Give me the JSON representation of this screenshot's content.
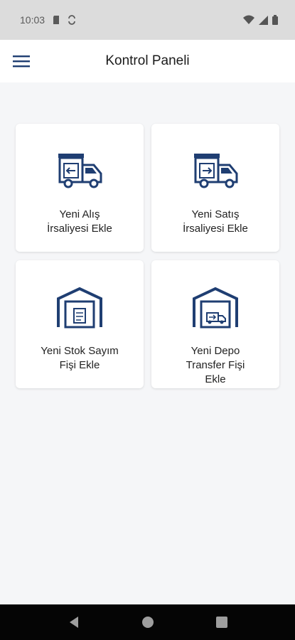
{
  "status_bar": {
    "time": "10:03",
    "icons": [
      "sd-card-icon",
      "sync-icon",
      "wifi-icon",
      "signal-icon",
      "battery-icon"
    ]
  },
  "app_bar": {
    "title": "Kontrol Paneli",
    "menu_icon": "hamburger-menu-icon"
  },
  "dashboard": {
    "cards": [
      {
        "label": "Yeni Alış\nİrsaliyesi Ekle",
        "icon": "truck-receive-icon"
      },
      {
        "label": "Yeni Satış\nİrsaliyesi Ekle",
        "icon": "truck-send-icon"
      },
      {
        "label": "Yeni Stok Sayım\nFişi Ekle",
        "icon": "warehouse-count-icon"
      },
      {
        "label": "Yeni Depo\nTransfer Fişi\nEkle",
        "icon": "warehouse-transfer-icon"
      }
    ]
  },
  "nav_bar": {
    "buttons": [
      "back-icon",
      "home-icon",
      "recents-icon"
    ]
  },
  "colors": {
    "accent": "#1f3e72",
    "status_bar": "#dcdcdc",
    "background": "#f5f6f8",
    "nav_bar": "#050505"
  }
}
